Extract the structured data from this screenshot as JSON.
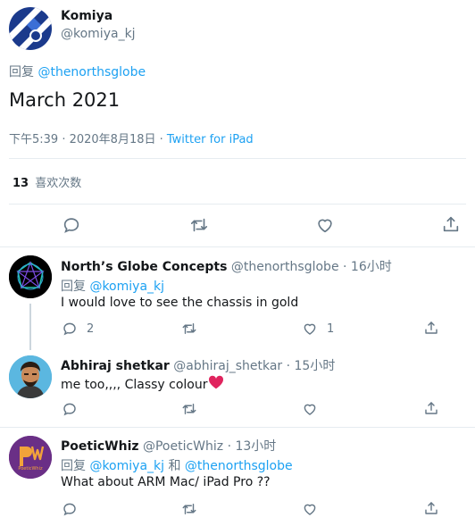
{
  "main_tweet": {
    "author_name": "Komiya",
    "author_handle": "@komiya_kj",
    "reply_prefix": "回复",
    "reply_to": "@thenorthsglobe",
    "text": "March 2021",
    "timestamp": "下午5:39 · 2020年8月18日 · ",
    "source": "Twitter for iPad",
    "likes_count": "13",
    "likes_label": "喜欢次数"
  },
  "replies": [
    {
      "name": "North’s Globe Concepts",
      "handle": "@thenorthsglobe · 16小时",
      "reply_prefix": "回复",
      "reply_to": "@komiya_kj",
      "text": "I would love to see the chassis in gold",
      "reply_count": "2",
      "like_count": "1"
    },
    {
      "name": "Abhiraj shetkar",
      "handle": "@abhiraj_shetkar · 15小时",
      "text": "me too,,,, Classy colour",
      "emoji": "❤️"
    },
    {
      "name": "PoeticWhiz",
      "handle": "@PoeticWhiz · 13小时",
      "reply_prefix": "回复",
      "reply_to": "@komiya_kj",
      "reply_and": "和",
      "reply_to_2": "@thenorthsglobe",
      "text": "What about ARM Mac/ iPad Pro ??",
      "avatar_text": "PoeticWhiz"
    }
  ],
  "colors": {
    "accent": "#1da1f2",
    "muted": "#657786",
    "like_heart": "#e0245e"
  }
}
